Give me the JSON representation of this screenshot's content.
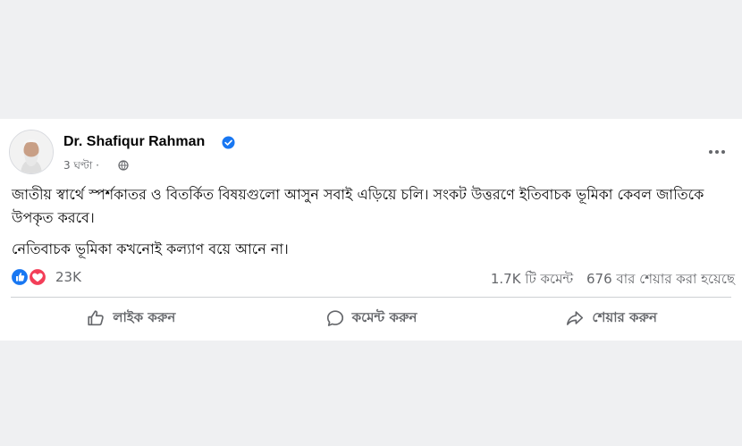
{
  "post": {
    "author_name": "Dr. Shafiqur Rahman",
    "timestamp": "3 ঘণ্টা ·",
    "paragraphs": [
      "জাতীয় স্বার্থে স্পর্শকাতর ও বিতর্কিত বিষয়গুলো আসুন সবাই এড়িয়ে চলি। সংকট উত্তরণে ইতিবাচক ভূমিকা কেবল জাতিকে উপকৃত করবে।",
      "নেতিবাচক ভূমিকা কখনোই কল্যাণ বয়ে আনে না।"
    ]
  },
  "reactions": {
    "count": "23K",
    "icons": [
      "like-icon",
      "love-icon"
    ],
    "comments": "1.7K টি কমেন্ট",
    "shares": "676 বার শেয়ার করা হয়েছে"
  },
  "actions": {
    "like": "লাইক করুন",
    "comment": "কমেন্ট করুন",
    "share": "শেয়ার করুন"
  },
  "colors": {
    "page_background": "#eff0f2",
    "card_background": "#ffffff",
    "verified_blue": "#1877f2",
    "like_blue": "#1877f2",
    "love_red": "#f33e58",
    "secondary_text": "#65676b"
  }
}
